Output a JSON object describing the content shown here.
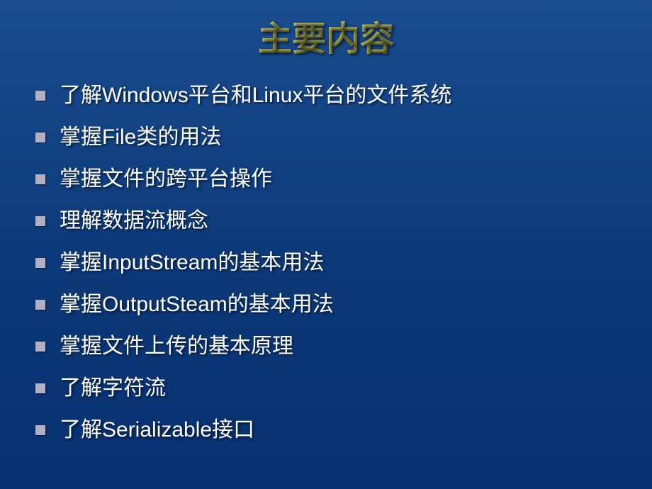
{
  "slide": {
    "title": "主要内容",
    "bullets": [
      "了解Windows平台和Linux平台的文件系统",
      "掌握File类的用法",
      "掌握文件的跨平台操作",
      "理解数据流概念",
      "掌握InputStream的基本用法",
      "掌握OutputSteam的基本用法",
      "掌握文件上传的基本原理",
      "了解字符流",
      "了解Serializable接口"
    ]
  }
}
